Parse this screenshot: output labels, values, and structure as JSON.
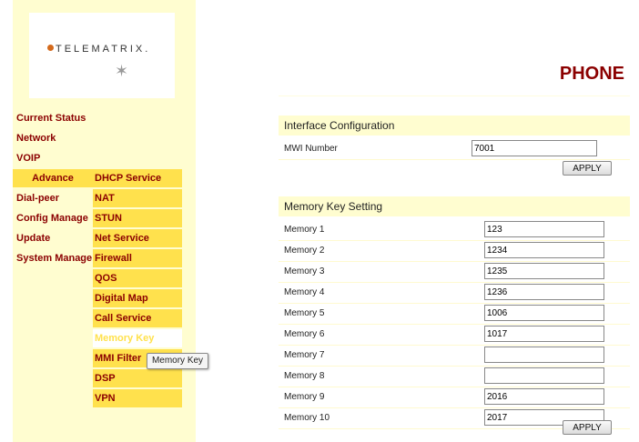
{
  "logo": {
    "text": "TELEMATRIX."
  },
  "page_title": "PHONE",
  "sidebar": {
    "items": [
      {
        "label": "Current Status"
      },
      {
        "label": "Network"
      },
      {
        "label": "VOIP"
      },
      {
        "label": "Dial-peer"
      },
      {
        "label": "Config Manage"
      },
      {
        "label": "Update"
      },
      {
        "label": "System Manage"
      }
    ],
    "advance_label": "Advance",
    "subitems": [
      {
        "label": "DHCP Service"
      },
      {
        "label": "NAT"
      },
      {
        "label": "STUN"
      },
      {
        "label": "Net Service"
      },
      {
        "label": "Firewall"
      },
      {
        "label": "QOS"
      },
      {
        "label": "Digital Map"
      },
      {
        "label": "Call Service"
      },
      {
        "label": "Memory Key"
      },
      {
        "label": "MMI Filter"
      },
      {
        "label": "DSP"
      },
      {
        "label": "VPN"
      }
    ]
  },
  "tooltip": "Memory Key",
  "interface_config": {
    "title": "Interface Configuration",
    "mwi_label": "MWI Number",
    "mwi_value": "7001",
    "apply_label": "APPLY"
  },
  "memory_keys": {
    "title": "Memory Key Setting",
    "rows": [
      {
        "label": "Memory 1",
        "value": "123"
      },
      {
        "label": "Memory 2",
        "value": "1234"
      },
      {
        "label": "Memory 3",
        "value": "1235"
      },
      {
        "label": "Memory 4",
        "value": "1236"
      },
      {
        "label": "Memory 5",
        "value": "1006"
      },
      {
        "label": "Memory 6",
        "value": "1017"
      },
      {
        "label": "Memory 7",
        "value": ""
      },
      {
        "label": "Memory 8",
        "value": ""
      },
      {
        "label": "Memory 9",
        "value": "2016"
      },
      {
        "label": "Memory 10",
        "value": "2017"
      }
    ],
    "apply_label": "APPLY"
  },
  "colors": {
    "nav_text": "#8b0000",
    "sidebar_bg": "#fffdd0",
    "subnav_bg": "#ffe14d",
    "title": "#8b0000"
  }
}
